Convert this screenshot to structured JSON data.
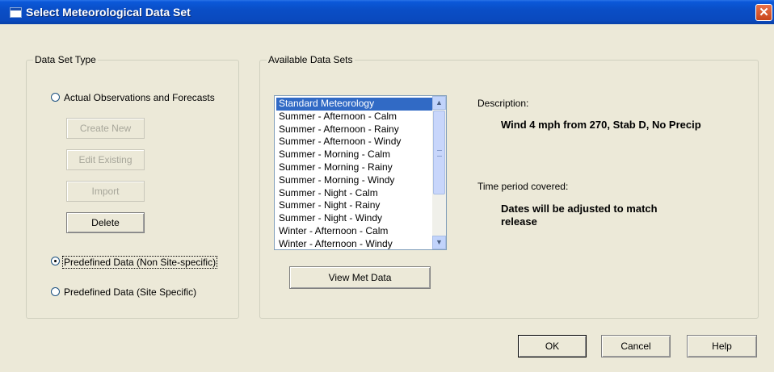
{
  "window": {
    "title": "Select Meteorological Data Set",
    "close_symbol": "✕"
  },
  "data_set_type": {
    "legend": "Data Set Type",
    "radio_actual": {
      "label": "Actual Observations and Forecasts",
      "checked": false
    },
    "buttons": {
      "create_new": "Create New",
      "edit_existing": "Edit Existing",
      "import": "Import",
      "delete": "Delete"
    },
    "radio_predefined_non_site": {
      "label": "Predefined Data (Non Site-specific)",
      "checked": true
    },
    "radio_predefined_site": {
      "label": "Predefined Data (Site Specific)",
      "checked": false
    }
  },
  "available_data_sets": {
    "legend": "Available Data Sets",
    "items": [
      "Standard Meteorology",
      "Summer - Afternoon - Calm",
      "Summer - Afternoon - Rainy",
      "Summer - Afternoon - Windy",
      "Summer - Morning - Calm",
      "Summer - Morning - Rainy",
      "Summer - Morning - Windy",
      "Summer - Night - Calm",
      "Summer - Night - Rainy",
      "Summer - Night - Windy",
      "Winter - Afternoon - Calm",
      "Winter - Afternoon - Windy"
    ],
    "selected": "Standard Meteorology",
    "view_button": "View Met Data",
    "scroll_up": "▲",
    "scroll_down": "▼",
    "description_label": "Description:",
    "description_value": "Wind 4 mph from 270, Stab D, No Precip",
    "time_period_label": "Time period covered:",
    "time_period_value_line1": "Dates will be adjusted to match",
    "time_period_value_line2": "release"
  },
  "footer": {
    "ok": "OK",
    "cancel": "Cancel",
    "help": "Help"
  }
}
